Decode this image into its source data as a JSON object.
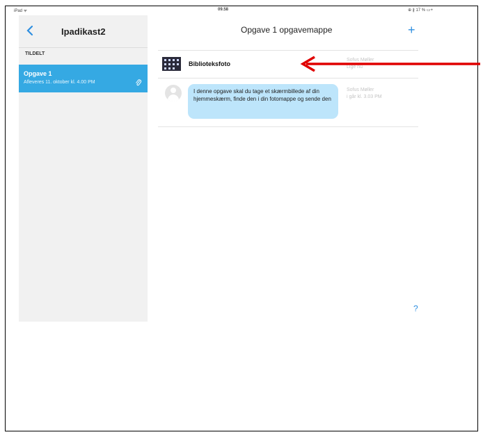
{
  "status_bar": {
    "device": "iPad ᯤ",
    "time": "09.58",
    "right": "⊕ ∦ 17 % ▭+"
  },
  "sidebar": {
    "title": "Ipadikast2",
    "section": "TILDELT",
    "assignment": {
      "title": "Opgave 1",
      "due": "Afleveres 11. oktober kl. 4.00 PM"
    }
  },
  "main": {
    "title": "Opgave 1 opgavemappe",
    "attachment": {
      "name": "Biblioteksfoto",
      "author": "Sofus Møller",
      "time": "Lige nu"
    },
    "message": {
      "text": "I denne opgave skal du tage et skærmbillede af din hjemmeskærm, finde den i din fotomappe og sende den",
      "author": "Sofus Møller",
      "time": "i går kl. 3.03 PM"
    },
    "help": "?"
  },
  "colors": {
    "accent": "#2f8fe0",
    "selected": "#35a9e3",
    "bubble": "#bde5fb",
    "arrow": "#e00000"
  }
}
